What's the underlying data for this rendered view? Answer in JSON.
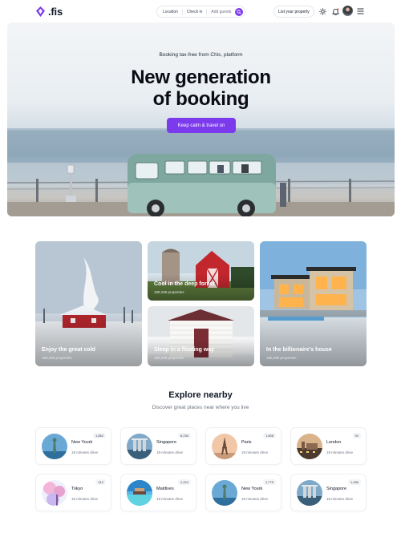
{
  "header": {
    "logo_text": ".fis",
    "search": {
      "location": "Location",
      "checkin": "Check in",
      "guests": "Add guests"
    },
    "list_property": "List your property",
    "icons": [
      "sun-icon",
      "bell-icon",
      "avatar",
      "menu-icon"
    ],
    "accent": "#7c3aed"
  },
  "hero": {
    "subtitle": "Booking tax-free from Chis, platform",
    "title_line1": "New generation",
    "title_line2": "of booking",
    "cta": "Keep calm & travel on"
  },
  "cards": [
    {
      "title": "Enjoy the great cold",
      "sub": "188,288 properties"
    },
    {
      "title": "Cool in the deep forest",
      "sub": "188,288 properties"
    },
    {
      "title": "Sleep in a floating way",
      "sub": "188,288 properties"
    },
    {
      "title": "In the billionaire's house",
      "sub": "188,288 properties"
    }
  ],
  "explore": {
    "title": "Explore nearby",
    "subtitle": "Discover great places near where you live",
    "places": [
      {
        "name": "New Yourk",
        "drive": "19 minutes drive",
        "count": "1,862"
      },
      {
        "name": "Singapore",
        "drive": "19 minutes drive",
        "count": "8,230"
      },
      {
        "name": "Paris",
        "drive": "19 minutes drive",
        "count": "1,808"
      },
      {
        "name": "London",
        "drive": "19 minutes drive",
        "count": "92"
      },
      {
        "name": "Tokyo",
        "drive": "19 minutes drive",
        "count": "312"
      },
      {
        "name": "Maldives",
        "drive": "19 minutes drive",
        "count": "2,222"
      },
      {
        "name": "New Yourk",
        "drive": "19 minutes drive",
        "count": "1,779"
      },
      {
        "name": "Singapore",
        "drive": "19 minutes drive",
        "count": "1,286"
      }
    ]
  }
}
